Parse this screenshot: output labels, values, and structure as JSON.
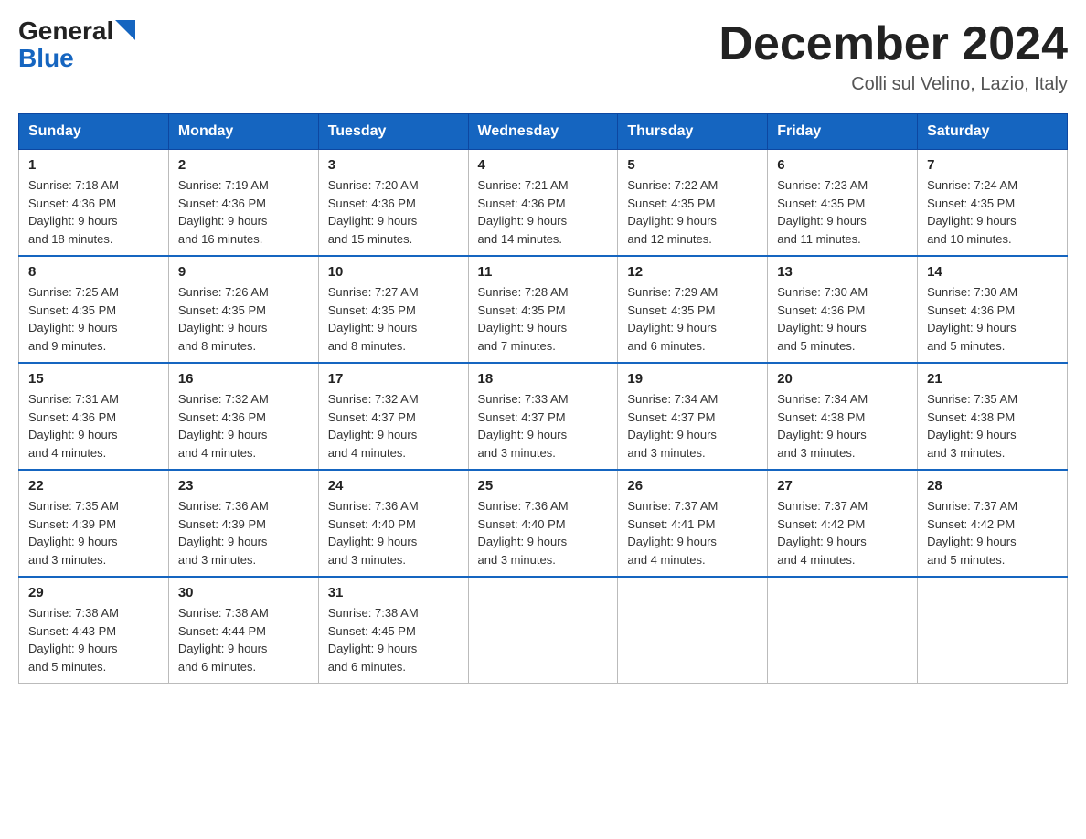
{
  "logo": {
    "general": "General",
    "blue": "Blue"
  },
  "title": "December 2024",
  "location": "Colli sul Velino, Lazio, Italy",
  "days_of_week": [
    "Sunday",
    "Monday",
    "Tuesday",
    "Wednesday",
    "Thursday",
    "Friday",
    "Saturday"
  ],
  "weeks": [
    [
      {
        "day": "1",
        "sunrise": "7:18 AM",
        "sunset": "4:36 PM",
        "daylight": "9 hours and 18 minutes."
      },
      {
        "day": "2",
        "sunrise": "7:19 AM",
        "sunset": "4:36 PM",
        "daylight": "9 hours and 16 minutes."
      },
      {
        "day": "3",
        "sunrise": "7:20 AM",
        "sunset": "4:36 PM",
        "daylight": "9 hours and 15 minutes."
      },
      {
        "day": "4",
        "sunrise": "7:21 AM",
        "sunset": "4:36 PM",
        "daylight": "9 hours and 14 minutes."
      },
      {
        "day": "5",
        "sunrise": "7:22 AM",
        "sunset": "4:35 PM",
        "daylight": "9 hours and 12 minutes."
      },
      {
        "day": "6",
        "sunrise": "7:23 AM",
        "sunset": "4:35 PM",
        "daylight": "9 hours and 11 minutes."
      },
      {
        "day": "7",
        "sunrise": "7:24 AM",
        "sunset": "4:35 PM",
        "daylight": "9 hours and 10 minutes."
      }
    ],
    [
      {
        "day": "8",
        "sunrise": "7:25 AM",
        "sunset": "4:35 PM",
        "daylight": "9 hours and 9 minutes."
      },
      {
        "day": "9",
        "sunrise": "7:26 AM",
        "sunset": "4:35 PM",
        "daylight": "9 hours and 8 minutes."
      },
      {
        "day": "10",
        "sunrise": "7:27 AM",
        "sunset": "4:35 PM",
        "daylight": "9 hours and 8 minutes."
      },
      {
        "day": "11",
        "sunrise": "7:28 AM",
        "sunset": "4:35 PM",
        "daylight": "9 hours and 7 minutes."
      },
      {
        "day": "12",
        "sunrise": "7:29 AM",
        "sunset": "4:35 PM",
        "daylight": "9 hours and 6 minutes."
      },
      {
        "day": "13",
        "sunrise": "7:30 AM",
        "sunset": "4:36 PM",
        "daylight": "9 hours and 5 minutes."
      },
      {
        "day": "14",
        "sunrise": "7:30 AM",
        "sunset": "4:36 PM",
        "daylight": "9 hours and 5 minutes."
      }
    ],
    [
      {
        "day": "15",
        "sunrise": "7:31 AM",
        "sunset": "4:36 PM",
        "daylight": "9 hours and 4 minutes."
      },
      {
        "day": "16",
        "sunrise": "7:32 AM",
        "sunset": "4:36 PM",
        "daylight": "9 hours and 4 minutes."
      },
      {
        "day": "17",
        "sunrise": "7:32 AM",
        "sunset": "4:37 PM",
        "daylight": "9 hours and 4 minutes."
      },
      {
        "day": "18",
        "sunrise": "7:33 AM",
        "sunset": "4:37 PM",
        "daylight": "9 hours and 3 minutes."
      },
      {
        "day": "19",
        "sunrise": "7:34 AM",
        "sunset": "4:37 PM",
        "daylight": "9 hours and 3 minutes."
      },
      {
        "day": "20",
        "sunrise": "7:34 AM",
        "sunset": "4:38 PM",
        "daylight": "9 hours and 3 minutes."
      },
      {
        "day": "21",
        "sunrise": "7:35 AM",
        "sunset": "4:38 PM",
        "daylight": "9 hours and 3 minutes."
      }
    ],
    [
      {
        "day": "22",
        "sunrise": "7:35 AM",
        "sunset": "4:39 PM",
        "daylight": "9 hours and 3 minutes."
      },
      {
        "day": "23",
        "sunrise": "7:36 AM",
        "sunset": "4:39 PM",
        "daylight": "9 hours and 3 minutes."
      },
      {
        "day": "24",
        "sunrise": "7:36 AM",
        "sunset": "4:40 PM",
        "daylight": "9 hours and 3 minutes."
      },
      {
        "day": "25",
        "sunrise": "7:36 AM",
        "sunset": "4:40 PM",
        "daylight": "9 hours and 3 minutes."
      },
      {
        "day": "26",
        "sunrise": "7:37 AM",
        "sunset": "4:41 PM",
        "daylight": "9 hours and 4 minutes."
      },
      {
        "day": "27",
        "sunrise": "7:37 AM",
        "sunset": "4:42 PM",
        "daylight": "9 hours and 4 minutes."
      },
      {
        "day": "28",
        "sunrise": "7:37 AM",
        "sunset": "4:42 PM",
        "daylight": "9 hours and 5 minutes."
      }
    ],
    [
      {
        "day": "29",
        "sunrise": "7:38 AM",
        "sunset": "4:43 PM",
        "daylight": "9 hours and 5 minutes."
      },
      {
        "day": "30",
        "sunrise": "7:38 AM",
        "sunset": "4:44 PM",
        "daylight": "9 hours and 6 minutes."
      },
      {
        "day": "31",
        "sunrise": "7:38 AM",
        "sunset": "4:45 PM",
        "daylight": "9 hours and 6 minutes."
      },
      null,
      null,
      null,
      null
    ]
  ],
  "labels": {
    "sunrise": "Sunrise:",
    "sunset": "Sunset:",
    "daylight": "Daylight:"
  }
}
